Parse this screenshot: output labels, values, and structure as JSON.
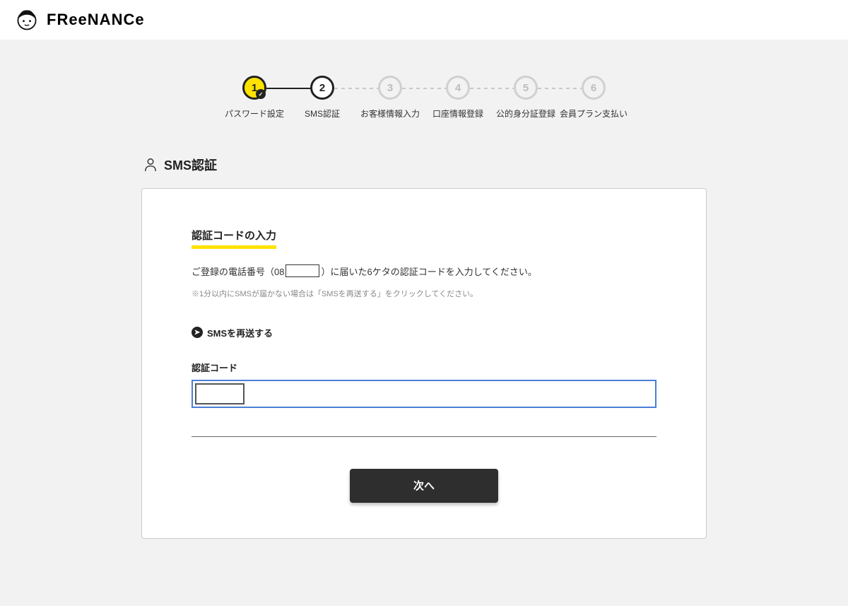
{
  "brand": {
    "name": "FReeNANCe"
  },
  "stepper": {
    "steps": [
      {
        "num": "1",
        "label": "パスワード設定",
        "state": "done"
      },
      {
        "num": "2",
        "label": "SMS認証",
        "state": "current"
      },
      {
        "num": "3",
        "label": "お客様情報入力",
        "state": "future"
      },
      {
        "num": "4",
        "label": "口座情報登録",
        "state": "future"
      },
      {
        "num": "5",
        "label": "公的身分証登録",
        "state": "future"
      },
      {
        "num": "6",
        "label": "会員プラン支払い",
        "state": "future"
      }
    ]
  },
  "section": {
    "title": "SMS認証"
  },
  "card": {
    "subheading": "認証コードの入力",
    "instruction_pre": "ご登録の電話番号（08",
    "instruction_post": "）に届いた6ケタの認証コードを入力してください。",
    "note": "※1分以内にSMSが届かない場合は「SMSを再送する」をクリックしてください。",
    "resend_label": "SMSを再送する",
    "field_label": "認証コード",
    "code_value": "",
    "next_button": "次へ"
  }
}
